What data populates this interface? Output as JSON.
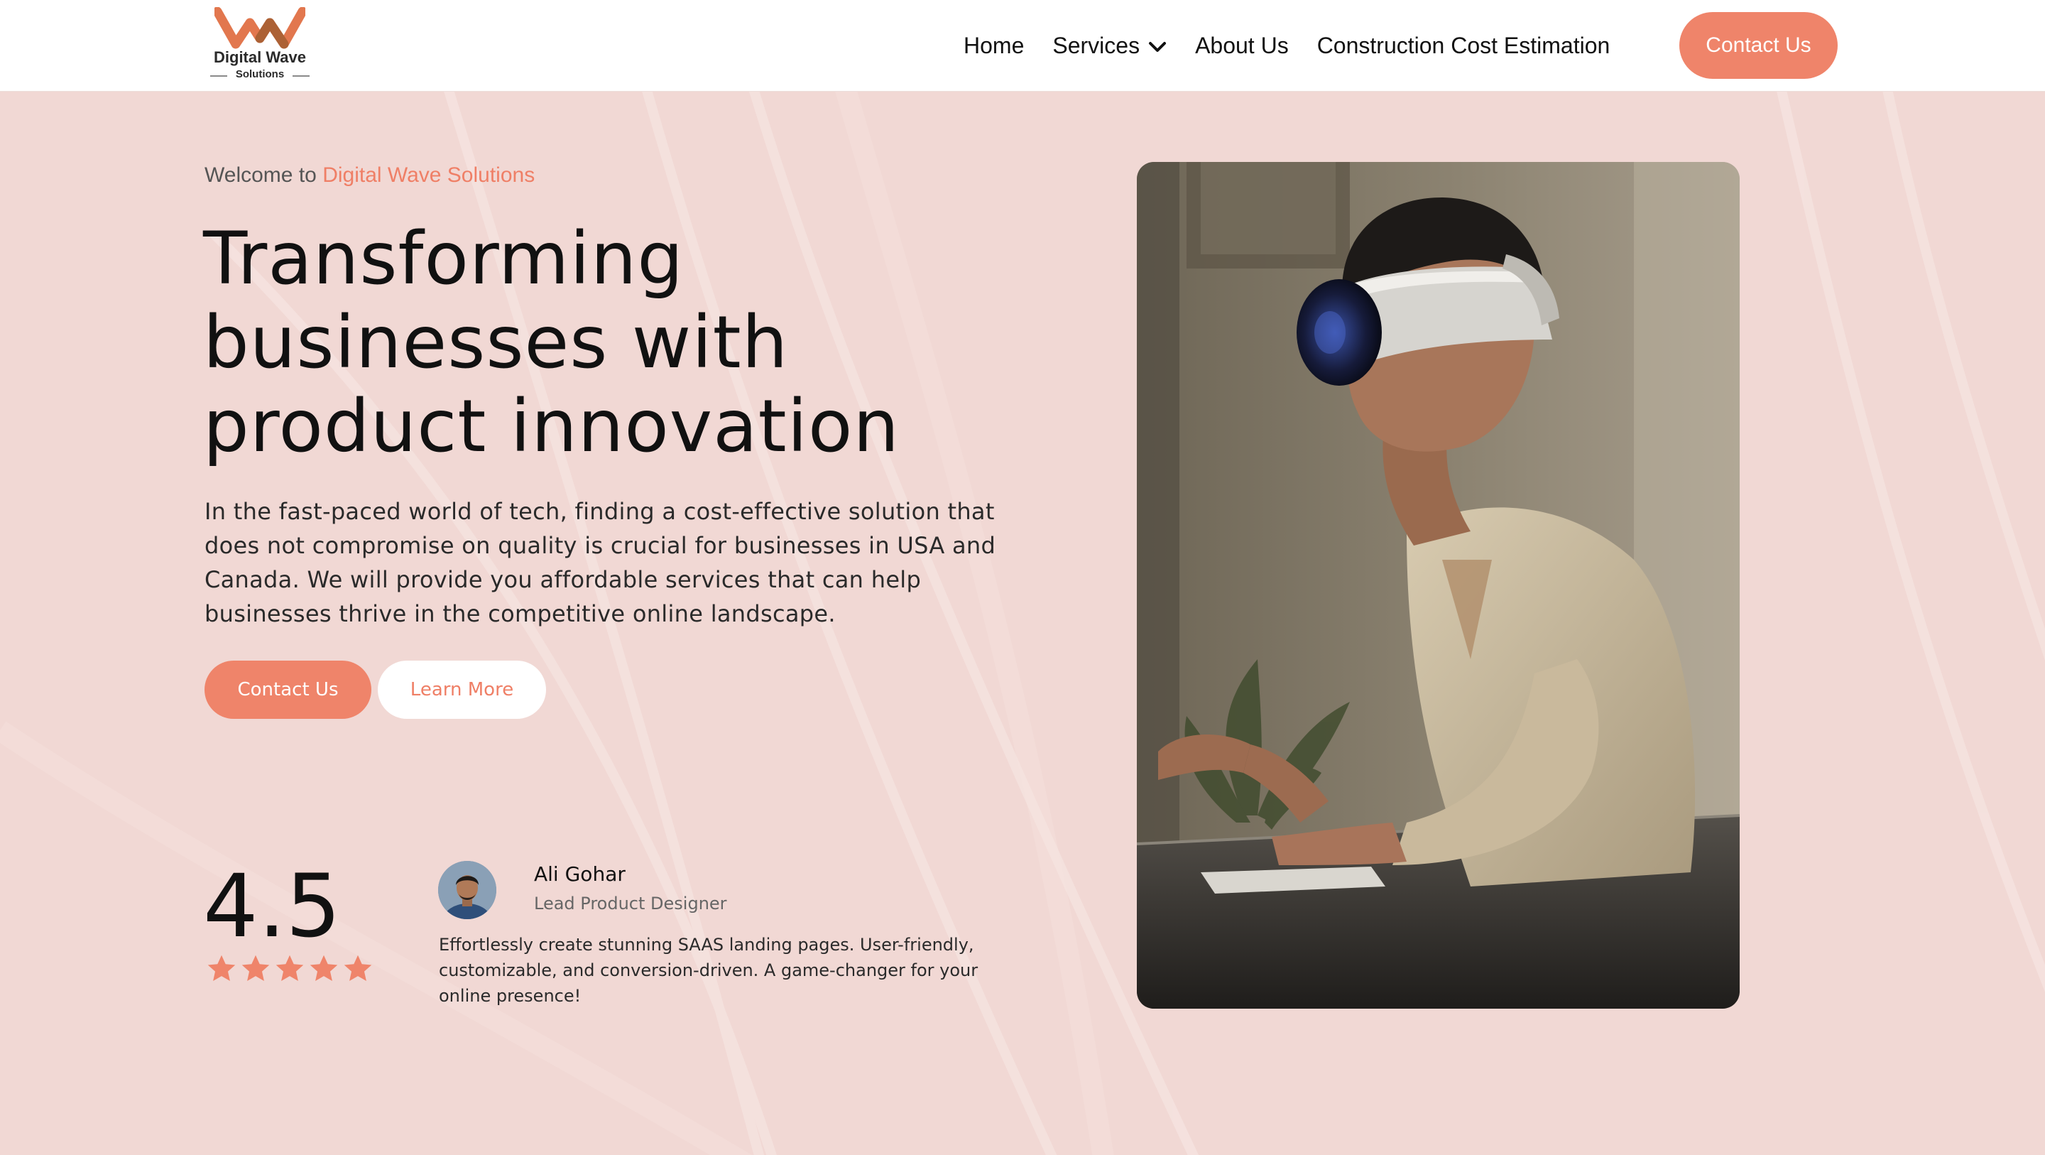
{
  "brand": {
    "name": "Digital Wave",
    "sub": "Solutions",
    "accent_color": "#ef846a",
    "background_color": "#f1d8d4"
  },
  "nav": {
    "items": [
      {
        "label": "Home"
      },
      {
        "label": "Services",
        "icon": "chevron-down-icon"
      },
      {
        "label": "About Us"
      },
      {
        "label": "Construction Cost Estimation"
      }
    ],
    "cta_label": "Contact Us"
  },
  "hero": {
    "welcome_prefix": "Welcome to",
    "welcome_brand": "Digital Wave Solutions",
    "headline": [
      "Transforming",
      "businesses with",
      "product innovation"
    ],
    "description": "In the fast-paced world of tech, finding a cost-effective solution that does not compromise on quality is crucial for businesses in USA and Canada. We will provide you affordable services that can help businesses thrive in the competitive online landscape.",
    "primary_button": "Contact Us",
    "secondary_button": "Learn More",
    "image_subject": "man wearing a VR headset typing at a desk"
  },
  "rating": {
    "value": "4.5",
    "stars": 5
  },
  "testimonial": {
    "name": "Ali Gohar",
    "role": "Lead Product Designer",
    "quote": "Effortlessly create stunning SAAS landing pages. User-friendly, customizable, and conversion-driven. A game-changer for your online presence!"
  }
}
